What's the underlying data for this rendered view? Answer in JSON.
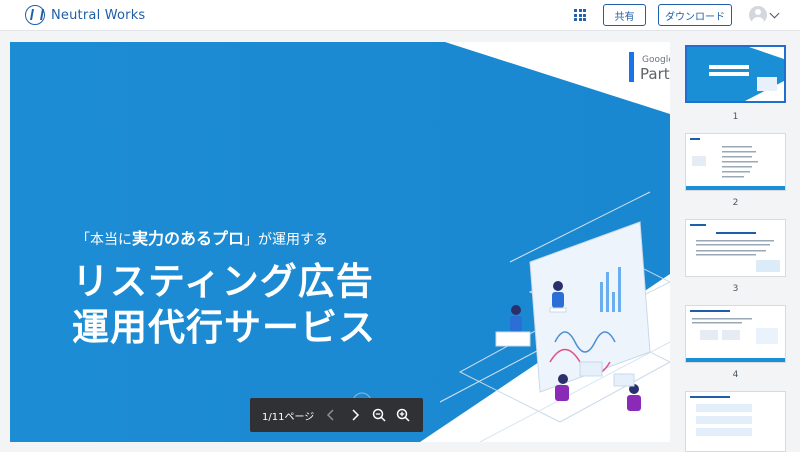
{
  "header": {
    "brand": "Neutral Works",
    "share_label": "共有",
    "download_label": "ダウンロード"
  },
  "slide": {
    "subtitle_pre": "「本当に",
    "subtitle_bold": "実力のあるプロ",
    "subtitle_post": "」が運用する",
    "title_line1": "リスティング広告",
    "title_line2": "運用代行サービス",
    "partner_google": "Google",
    "partner_part": "Part"
  },
  "viewer_controls": {
    "page_indicator": "1/11ページ"
  },
  "thumbnails": [
    {
      "number": "1"
    },
    {
      "number": "2"
    },
    {
      "number": "3"
    },
    {
      "number": "4"
    }
  ],
  "colors": {
    "brand_blue": "#1f5fa8",
    "slide_blue": "#1a8fd6",
    "accent": "#1f6fd1"
  }
}
